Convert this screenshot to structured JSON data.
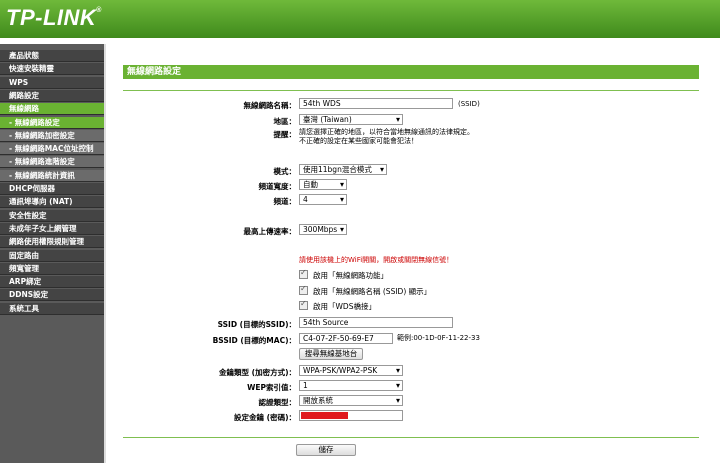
{
  "brand": {
    "logo": "TP-LINK",
    "reg": "®"
  },
  "sidebar": {
    "items": [
      {
        "label": "產品狀態",
        "sub": false,
        "active": false
      },
      {
        "label": "快速安裝精靈",
        "sub": false,
        "active": false
      },
      {
        "label": "WPS",
        "sub": false,
        "active": false
      },
      {
        "label": "網路設定",
        "sub": false,
        "active": false
      },
      {
        "label": "無線網路",
        "sub": false,
        "active": true
      },
      {
        "label": "- 無線網路設定",
        "sub": true,
        "active": true
      },
      {
        "label": "- 無線網路加密設定",
        "sub": true,
        "active": false
      },
      {
        "label": "- 無線網路MAC位址控制",
        "sub": true,
        "active": false
      },
      {
        "label": "- 無線網路進階設定",
        "sub": true,
        "active": false
      },
      {
        "label": "- 無線網路統計資訊",
        "sub": true,
        "active": false
      },
      {
        "label": "DHCP伺服器",
        "sub": false,
        "active": false
      },
      {
        "label": "通訊埠導向 (NAT)",
        "sub": false,
        "active": false
      },
      {
        "label": "安全性設定",
        "sub": false,
        "active": false
      },
      {
        "label": "未成年子女上網管理",
        "sub": false,
        "active": false
      },
      {
        "label": "網路使用權限規則管理",
        "sub": false,
        "active": false
      },
      {
        "label": "固定路由",
        "sub": false,
        "active": false
      },
      {
        "label": "頻寬管理",
        "sub": false,
        "active": false
      },
      {
        "label": "ARP綁定",
        "sub": false,
        "active": false
      },
      {
        "label": "DDNS設定",
        "sub": false,
        "active": false
      },
      {
        "label": "系統工具",
        "sub": false,
        "active": false
      }
    ]
  },
  "page": {
    "title": "無線網路設定"
  },
  "form": {
    "ssid_label": "無線網路名稱：",
    "ssid_value": "54th WDS",
    "ssid_hint": "(SSID)",
    "region_label": "地區：",
    "region_value": "臺灣 (Taiwan)",
    "warning_label": "提醒：",
    "warning_line1": "請您選擇正確的地區，以符合當地無線通訊的法律規定。",
    "warning_line2": "不正確的設定在某些國家可能會犯法！",
    "mode_label": "模式：",
    "mode_value": "使用11bgn混合模式",
    "width_label": "頻道寬度：",
    "width_value": "自動",
    "channel_label": "頻道：",
    "channel_value": "4",
    "rate_label": "最高上傳速率：",
    "rate_value": "300Mbps",
    "wifi_notice": "請使用該機上的WiFi開關，開啟或關閉無線信號！",
    "chk_enable_wireless": "啟用「無線網路功能」",
    "chk_broadcast_ssid": "啟用「無線網路名稱 (SSID) 顯示」",
    "chk_wds": "啟用「WDS橋接」",
    "bridge_ssid_label": "SSID (目標的SSID)：",
    "bridge_ssid_value": "54th Source",
    "bssid_label": "BSSID (目標的MAC)：",
    "bssid_value": "C4-07-2F-50-69-E7",
    "bssid_example": "範例:00-1D-0F-11-22-33",
    "survey_button": "搜尋無線基地台",
    "key_type_label": "金鑰類型 (加密方式)：",
    "key_type_value": "WPA-PSK/WPA2-PSK",
    "wep_index_label": "WEP索引值：",
    "wep_index_value": "1",
    "auth_label": "認證類型：",
    "auth_value": "開放系統",
    "password_label": "設定金鑰 (密碼)：",
    "save_button": "儲存"
  },
  "colors": {
    "brand_green": "#6ab232",
    "redaction": "#e0191e"
  }
}
